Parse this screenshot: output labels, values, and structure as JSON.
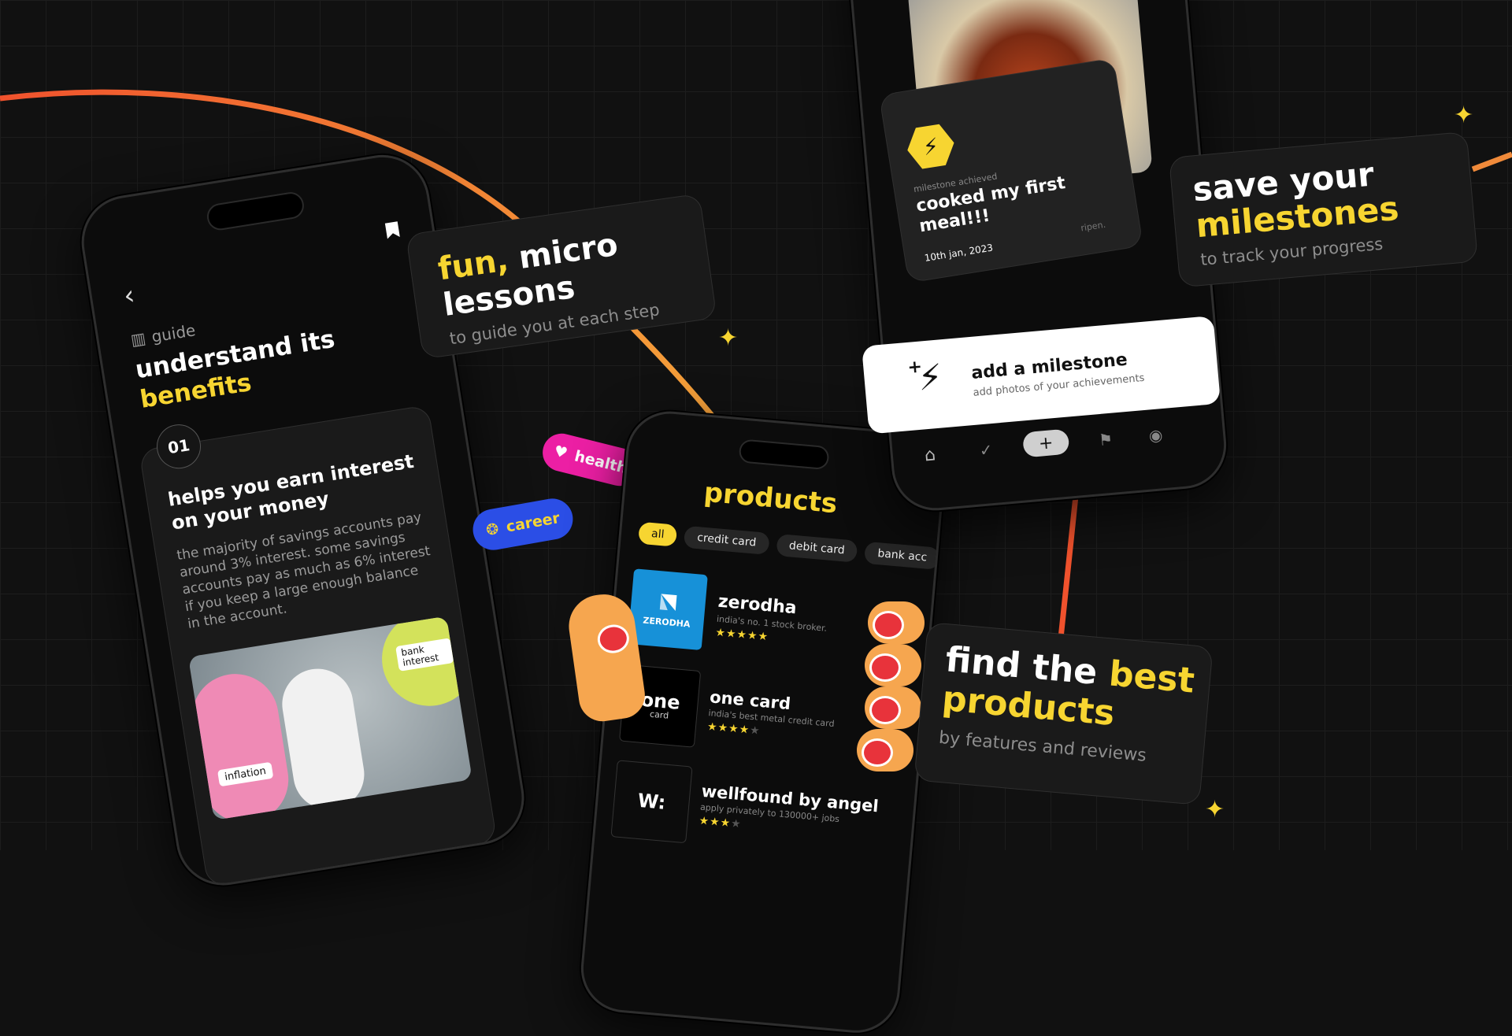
{
  "lesson_phone": {
    "section_label": "guide",
    "title_line1": "understand its",
    "title_highlight": "benefits",
    "step_number": "01",
    "card_title_line1": "helps you earn interest",
    "card_title_line2": "on your money",
    "card_body": "the majority of savings accounts pay around 3% interest. some savings accounts pay as much as 6% interest if you keep a large enough balance in the account.",
    "illustration": {
      "tag_left": "inflation",
      "tag_right": "bank interest"
    }
  },
  "lessons_callout": {
    "highlight": "fun,",
    "title_rest": " micro",
    "title_line2": "lessons",
    "subtitle": "to guide you at each step"
  },
  "tags": {
    "health": "health",
    "career": "career"
  },
  "products_phone": {
    "title": "products",
    "filters": [
      "all",
      "credit card",
      "debit card",
      "bank acc"
    ],
    "items": [
      {
        "name": "zerodha",
        "description": "india's no. 1 stock broker.",
        "logo_text": "ZERODHA",
        "rating": 5
      },
      {
        "name": "one card",
        "description": "india's best metal credit card",
        "logo_text": "one",
        "logo_sub": "card",
        "rating": 4
      },
      {
        "name": "wellfound by angel",
        "description": "apply privately to 130000+ jobs",
        "logo_text": "W:",
        "rating": 3
      }
    ]
  },
  "products_callout": {
    "title_start": "find the ",
    "title_highlight": "best",
    "title_line2": "products",
    "subtitle": "by features and reviews"
  },
  "milestone_phone": {
    "milestone_label": "milestone achieved",
    "milestone_title": "cooked my first meal!!!",
    "milestone_date": "10th jan, 2023",
    "brand": "ripen.",
    "add_title": "add a milestone",
    "add_subtitle": "add photos of your achievements",
    "nav_add": "+"
  },
  "milestones_callout": {
    "title_line1": "save your",
    "title_highlight": "milestones",
    "subtitle": "to track your progress"
  },
  "colors": {
    "accent_yellow": "#f7d531",
    "arc_orange": "#f08a3a",
    "tag_pink": "#ec1fa4",
    "tag_blue": "#2b4ee6",
    "finger": "#f6a64f",
    "nail": "#e8333b",
    "zerodha_blue": "#1791d8"
  }
}
